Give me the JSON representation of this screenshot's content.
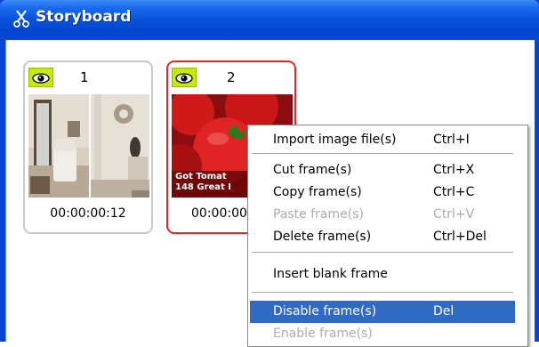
{
  "window": {
    "title": "Storyboard"
  },
  "frames": [
    {
      "number": "1",
      "timecode": "00:00:00:12"
    },
    {
      "number": "2",
      "timecode": "00:00:00",
      "overlay_line1": "Got Tomat",
      "overlay_line2": "148 Great I"
    }
  ],
  "context_menu": {
    "items": [
      {
        "label": "Import image file(s)",
        "shortcut": "Ctrl+I",
        "enabled": true
      },
      {
        "label": "Cut frame(s)",
        "shortcut": "Ctrl+X",
        "enabled": true
      },
      {
        "label": "Copy frame(s)",
        "shortcut": "Ctrl+C",
        "enabled": true
      },
      {
        "label": "Paste frame(s)",
        "shortcut": "Ctrl+V",
        "enabled": false
      },
      {
        "label": "Delete frame(s)",
        "shortcut": "Ctrl+Del",
        "enabled": true
      },
      {
        "label": "Insert blank frame",
        "shortcut": "",
        "enabled": true
      },
      {
        "label": "Disable frame(s)",
        "shortcut": "Del",
        "enabled": true,
        "highlighted": true
      },
      {
        "label": "Enable frame(s)",
        "shortcut": "",
        "enabled": false
      }
    ]
  },
  "colors": {
    "titlebar": "#0a55dd",
    "selected_border": "#e02828",
    "eye_button": "#c6ea00",
    "menu_highlight": "#316ac5"
  },
  "icons": {
    "title": "storyboard-scissors-icon",
    "visibility": "eye-icon"
  }
}
